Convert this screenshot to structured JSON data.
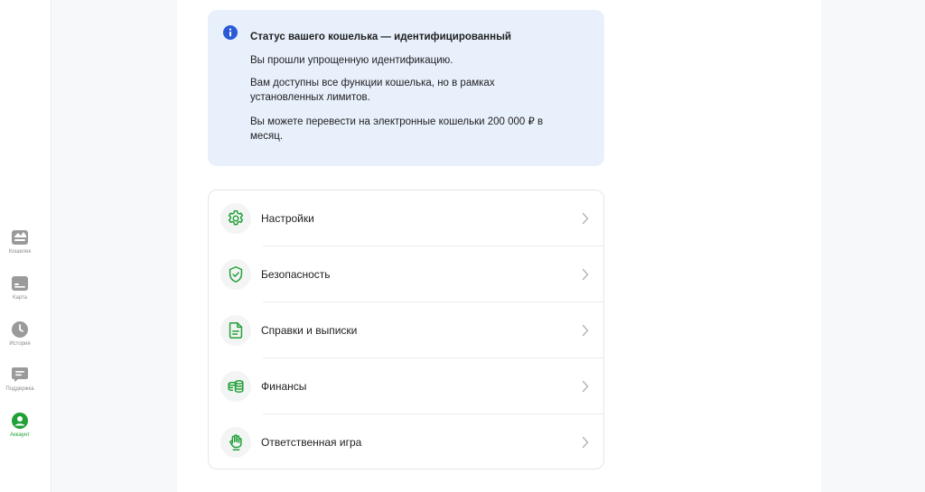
{
  "sidebar": {
    "items": [
      {
        "label": "Кошелек",
        "icon": "wallet-icon",
        "active": false
      },
      {
        "label": "Карта",
        "icon": "card-icon",
        "active": false
      },
      {
        "label": "История",
        "icon": "clock-icon",
        "active": false
      },
      {
        "label": "Поддержка",
        "icon": "chat-icon",
        "active": false
      },
      {
        "label": "Аккаунт",
        "icon": "user-icon",
        "active": true
      }
    ]
  },
  "status_box": {
    "icon": "info-icon",
    "title": "Статус вашего кошелька — идентифицированный",
    "lines": [
      "Вы прошли упрощенную идентификацию.",
      "Вам доступны все функции кошелька, но в рамках установленных лимитов.",
      "Вы можете перевести на электронные кошельки 200 000 ₽ в месяц."
    ]
  },
  "menu": {
    "items": [
      {
        "label": "Настройки",
        "icon": "gear-icon"
      },
      {
        "label": "Безопасность",
        "icon": "shield-check-icon"
      },
      {
        "label": "Справки и выписки",
        "icon": "document-icon"
      },
      {
        "label": "Финансы",
        "icon": "coins-icon"
      },
      {
        "label": "Ответственная игра",
        "icon": "hand-icon"
      }
    ]
  },
  "colors": {
    "accent": "#21a038",
    "info_bg": "#e8f0fc",
    "info_icon": "#2a5bd7",
    "nav_inactive": "#9a9a9a"
  }
}
